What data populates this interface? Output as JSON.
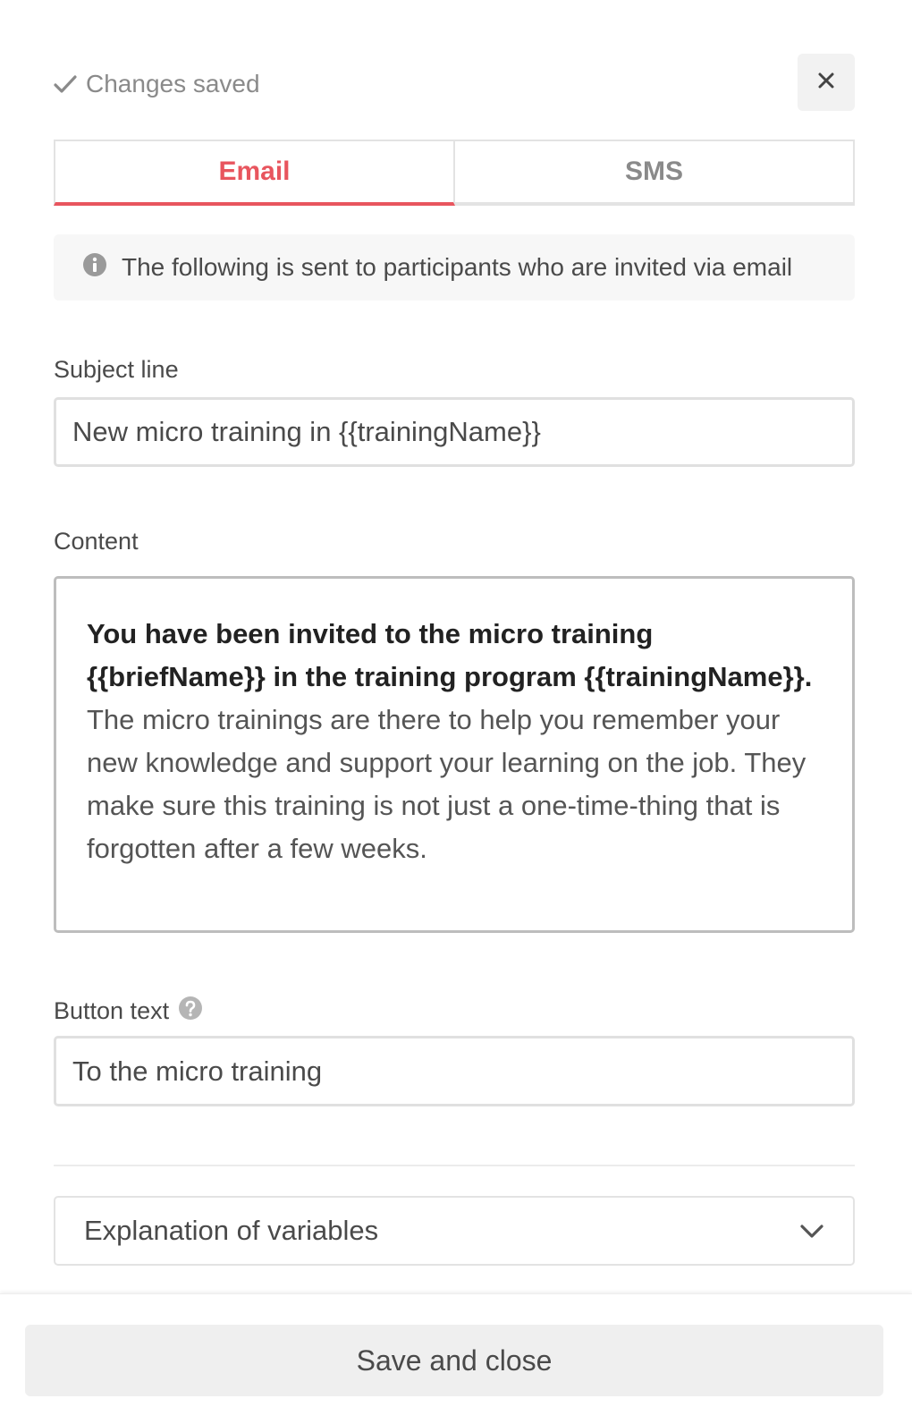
{
  "status": {
    "icon": "checkmark-icon",
    "text": "Changes saved"
  },
  "close": {
    "icon": "close-icon"
  },
  "tabs": [
    {
      "label": "Email",
      "active": true
    },
    {
      "label": "SMS",
      "active": false
    }
  ],
  "info": {
    "icon": "info-icon",
    "text": "The following is sent to participants who are invited via email"
  },
  "subject": {
    "label": "Subject line",
    "value": "New micro training in {{trainingName}}"
  },
  "content": {
    "label": "Content",
    "bold_text": "You have been invited to the micro training {{briefName}} in the training program {{trainingName}}.",
    "body_text": " The micro trainings are there to help you remember your new knowledge and support your learning on the job. They make sure this training is not just a one-time-thing that is forgotten after a few weeks."
  },
  "button_text": {
    "label": "Button text",
    "help_icon": "question-circle-icon",
    "value": "To the micro training"
  },
  "variables": {
    "label": "Explanation of variables",
    "icon": "chevron-down-icon"
  },
  "footer": {
    "save_label": "Save and close"
  },
  "colors": {
    "accent": "#e8555e",
    "muted": "#8a8a8a"
  }
}
